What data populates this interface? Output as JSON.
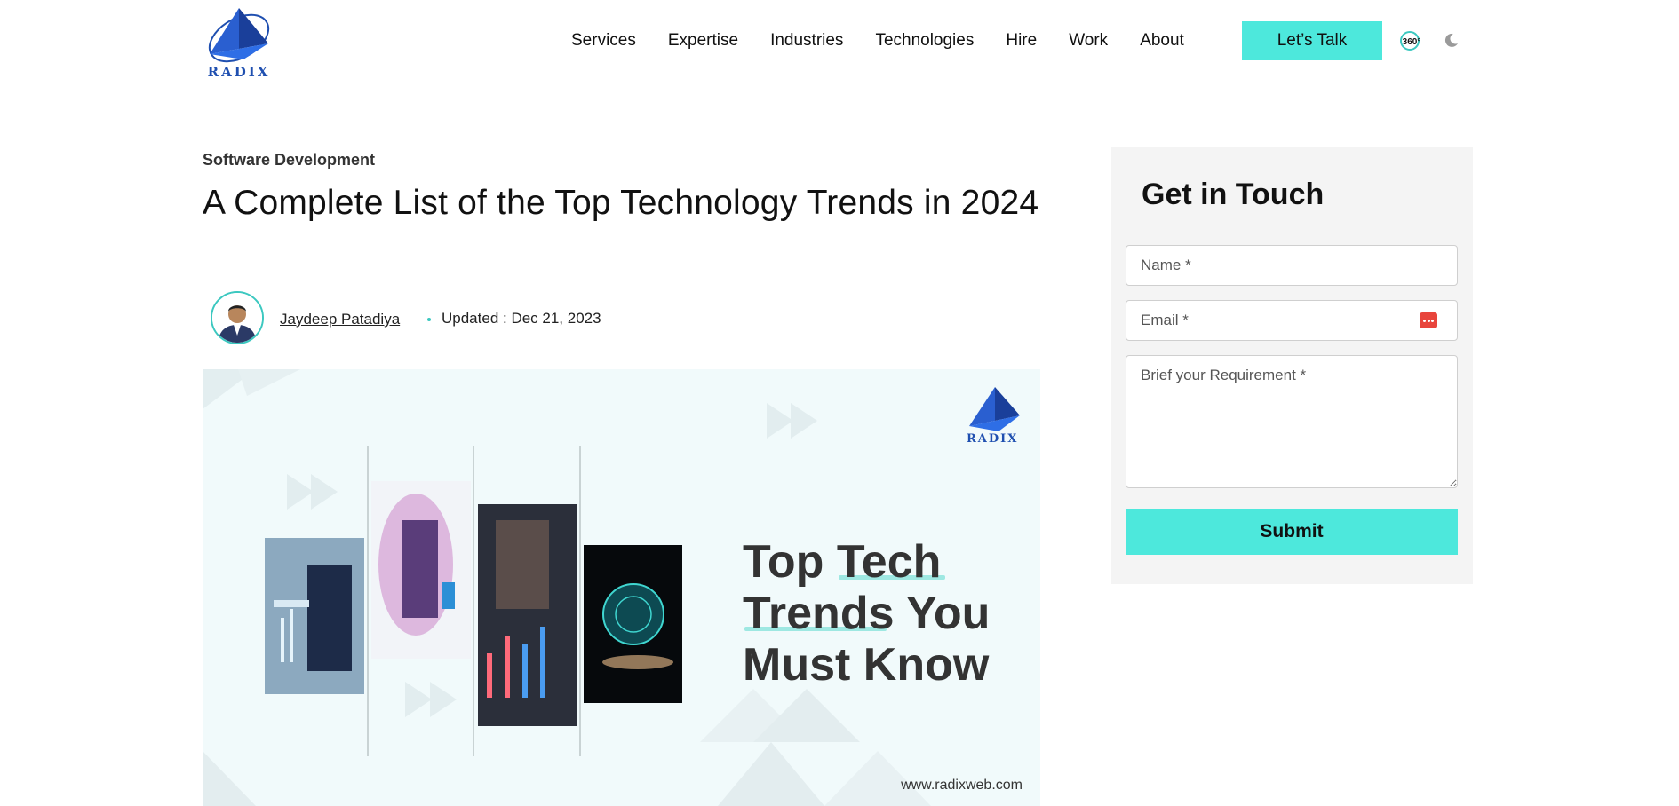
{
  "header": {
    "logo_text": "RADIX",
    "nav": [
      "Services",
      "Expertise",
      "Industries",
      "Technologies",
      "Hire",
      "Work",
      "About"
    ],
    "cta_label": "Let’s Talk",
    "icon_360_label": "360°",
    "theme_icon": "moon-icon"
  },
  "article": {
    "category": "Software Development",
    "title": "A Complete List of the Top Technology Trends in 2024",
    "author": "Jaydeep Patadiya",
    "updated": "Updated : Dec 21, 2023"
  },
  "hero": {
    "headline_1": "Top Tech",
    "headline_2": "Trends You",
    "headline_3": "Must Know",
    "logo_text": "RADIX",
    "url": "www.radixweb.com"
  },
  "contact": {
    "heading": "Get in Touch",
    "name_placeholder": "Name *",
    "email_placeholder": "Email *",
    "brief_placeholder": "Brief your Requirement *",
    "submit_label": "Submit"
  },
  "colors": {
    "accent": "#4de8dc",
    "brand_blue": "#1f4fb0"
  }
}
